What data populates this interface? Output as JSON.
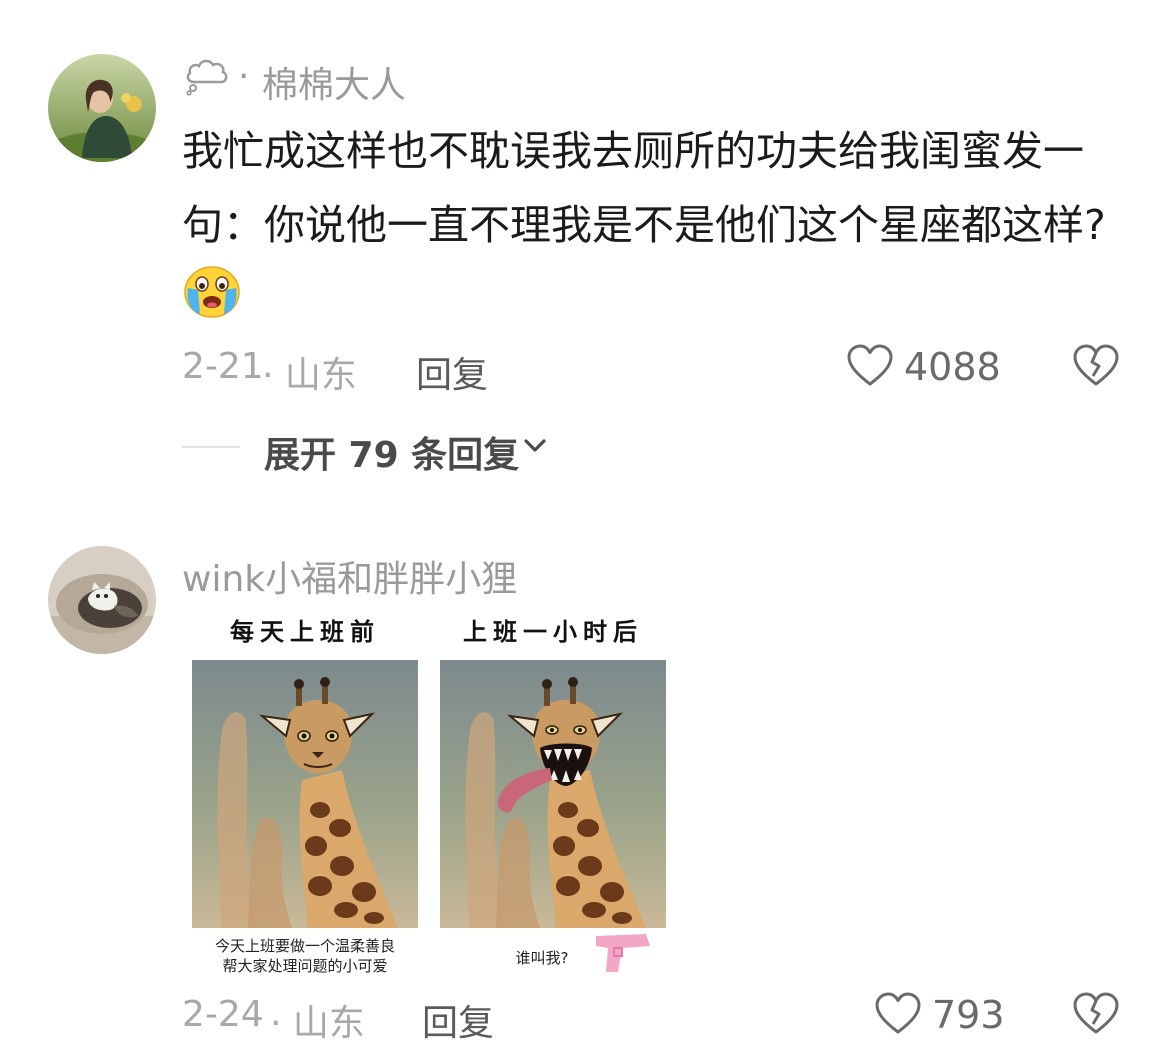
{
  "comments": [
    {
      "user": {
        "status_icon": "cloud-thought-icon",
        "status_sep": "·",
        "name": "棉棉大人"
      },
      "text": "我忙成这样也不耽误我去厕所的功夫给我闺蜜发一句：你说他一直不理我是不是他们这个星座都这样?",
      "emoji": "loudly-crying-face",
      "date": "2-21",
      "location": "· 山东",
      "reply_label": "回复",
      "like_count": "4088",
      "replies": {
        "label": "展开 79 条回复"
      }
    },
    {
      "user": {
        "name": "wink小福和胖胖小狸"
      },
      "meme": {
        "left_title": "每天上班前",
        "right_title": "上班一小时后",
        "left_caption_line1": "今天上班要做一个温柔善良",
        "left_caption_line2": "帮大家处理问题的小可爱",
        "right_caption": "谁叫我?"
      },
      "date": "2-24",
      "location": "· 山东",
      "reply_label": "回复",
      "like_count": "793"
    }
  ]
}
